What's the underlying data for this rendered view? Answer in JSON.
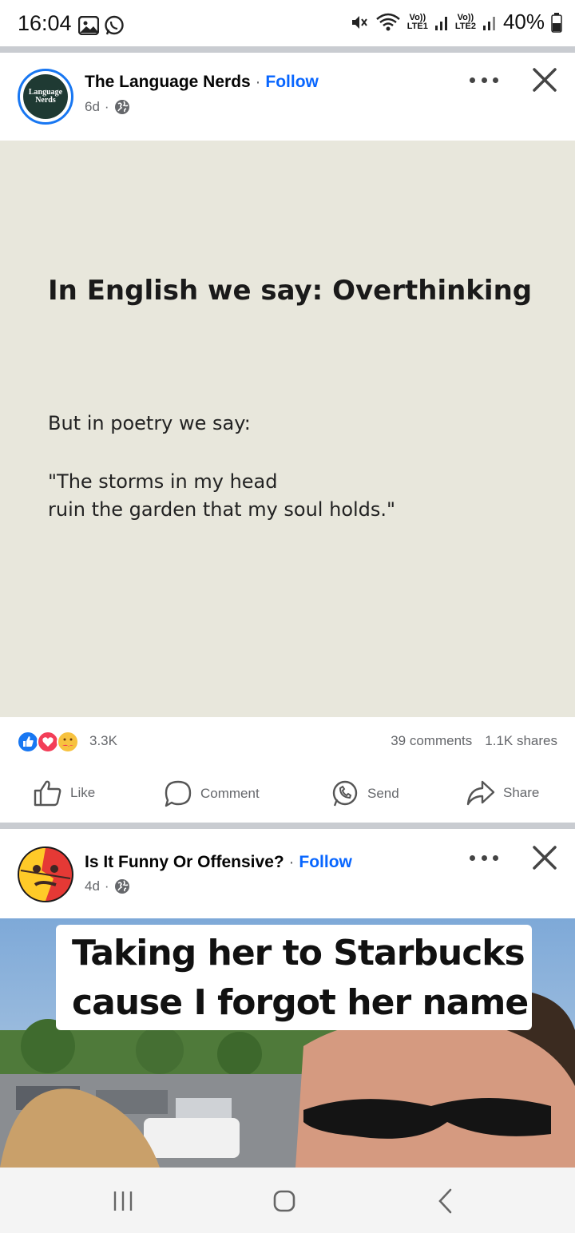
{
  "status_bar": {
    "time": "16:04",
    "sim1_top": "Vo))",
    "sim1_bottom": "LTE1",
    "sim2_top": "Vo))",
    "sim2_bottom": "LTE2",
    "battery": "40%",
    "icons": [
      "gallery-icon",
      "whatsapp-icon",
      "mute-icon",
      "wifi-icon",
      "signal-icon",
      "battery-icon"
    ]
  },
  "post1": {
    "page_name": "The Language Nerds",
    "separator": "·",
    "follow_label": "Follow",
    "time_ago": "6d",
    "meta_separator": "·",
    "avatar_text_line1": "Language",
    "avatar_text_line2": "Nerds",
    "image": {
      "headline": "In English we say: Overthinking",
      "subline": "But in poetry we say:",
      "quote_line1": "\"The storms in my head",
      "quote_line2": "ruin the garden that my soul holds.\""
    },
    "reaction_count": "3.3K",
    "comments": "39 comments",
    "shares": "1.1K shares"
  },
  "actions": {
    "like": "Like",
    "comment": "Comment",
    "send": "Send",
    "share": "Share"
  },
  "post2": {
    "page_name": "Is It Funny Or Offensive?",
    "separator": "·",
    "follow_label": "Follow",
    "time_ago": "4d",
    "meta_separator": "·",
    "image": {
      "caption_line1": "Taking her to Starbucks",
      "caption_line2": "cause I forgot her name"
    }
  },
  "colors": {
    "accent": "#0866ff",
    "like_blue": "#1877f2",
    "love_red": "#f33e58",
    "card_background": "#e8e7dc",
    "divider": "#c9ccd1"
  }
}
